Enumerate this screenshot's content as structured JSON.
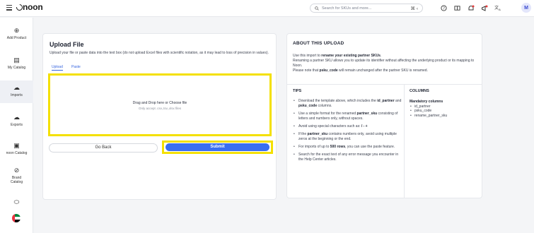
{
  "header": {
    "logo": "noon",
    "search_placeholder": "Search for SKUs and more...",
    "avatar_initial": "M"
  },
  "sidebar": {
    "items": [
      {
        "label": "Add Product",
        "icon": "plus-circle-icon"
      },
      {
        "label": "My Catalog",
        "icon": "catalog-icon"
      },
      {
        "label": "Imports",
        "icon": "upload-cloud-icon"
      },
      {
        "label": "Exports",
        "icon": "download-cloud-icon"
      },
      {
        "label": "noon Catalog",
        "icon": "box-icon"
      },
      {
        "label": "Brand Catalog",
        "icon": "check-circle-icon"
      },
      {
        "label": "",
        "icon": "tag-icon"
      },
      {
        "label": "",
        "icon": "uae-flag-icon"
      }
    ]
  },
  "upload": {
    "title": "Upload File",
    "description": "Upload your file or paste data into the text box (do not upload Excel files with scientific notation, as it may lead to loss of precision in values).",
    "tabs": [
      "Upload",
      "Paste"
    ],
    "dropzone_main": "Drag and Drop here or Choose file",
    "dropzone_sub": "Only accept .csv,.tsv,.xlsx files",
    "go_back_label": "Go Back",
    "submit_label": "Submit"
  },
  "about": {
    "title": "ABOUT THIS UPLOAD",
    "line1_prefix": "Use this import to ",
    "line1_bold": "rename your existing partner SKUs",
    "line1_suffix": ".",
    "line2": "Renaming a partner SKU allows you to update its identifier without affecting the underlying product or its mapping to Noon.",
    "line3_prefix": "Please note that ",
    "line3_bold": "psku_code",
    "line3_suffix": " will remain unchanged after the partner SKU is renamed.",
    "tips_title": "TIPS",
    "tips": [
      {
        "pre": "Download the template above, which includes the ",
        "b1": "id_partner",
        "mid": " and ",
        "b2": "psku_code",
        "post": " columns."
      },
      {
        "pre": "Use a simple format for the renamed ",
        "b1": "partner_sku",
        "mid": " consisting of letters and numbers only, without spaces.",
        "b2": "",
        "post": ""
      },
      {
        "pre": "Avoid using special characters such as: ",
        "b1": "/ - +",
        "mid": "",
        "b2": "",
        "post": ""
      },
      {
        "pre": "If the ",
        "b1": "partner_sku",
        "mid": " contains numbers only, avoid using multiple zeros at the beginning or the end.",
        "b2": "",
        "post": ""
      },
      {
        "pre": "For imports of up to ",
        "b1": "500 rows",
        "mid": ", you can use the paste feature.",
        "b2": "",
        "post": ""
      },
      {
        "pre": "Search for the exact text of any error message you encounter in the Help Center articles.",
        "b1": "",
        "mid": "",
        "b2": "",
        "post": ""
      }
    ],
    "columns_title": "COLUMNS",
    "mandatory_label": "Mandatory columns",
    "columns": [
      "id_partner",
      "psku_code",
      "rename_partner_sku"
    ]
  },
  "colors": {
    "accent": "#3a6ef0",
    "highlight": "#f4e000",
    "background": "#f4f5f7"
  }
}
